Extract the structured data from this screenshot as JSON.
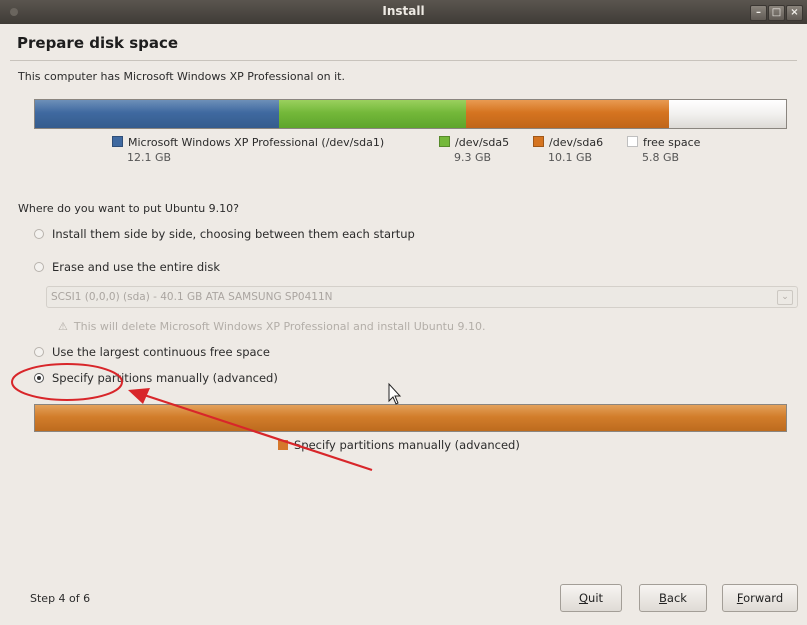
{
  "window": {
    "title": "Install",
    "controls": [
      "minimize",
      "maximize",
      "close"
    ]
  },
  "page": {
    "heading": "Prepare disk space",
    "intro": "This computer has Microsoft Windows XP Professional on it."
  },
  "disk_bar": {
    "segments": [
      {
        "label": "Microsoft Windows XP Professional (/dev/sda1)",
        "size": "12.1 GB",
        "gb": 12.1,
        "color": "#3f69a0"
      },
      {
        "label": "/dev/sda5",
        "size": "9.3 GB",
        "gb": 9.3,
        "color": "#74b83a"
      },
      {
        "label": "/dev/sda6",
        "size": "10.1 GB",
        "gb": 10.1,
        "color": "#d57420"
      },
      {
        "label": "free space",
        "size": "5.8 GB",
        "gb": 5.8,
        "color": "#ffffff"
      }
    ]
  },
  "question": "Where do you want to put Ubuntu 9.10?",
  "options": {
    "side_by_side": "Install them side by side, choosing between them each startup",
    "erase": "Erase and use the entire disk",
    "disk_select": "SCSI1 (0,0,0) (sda) - 40.1 GB ATA SAMSUNG SP0411N",
    "warning": "This will delete Microsoft Windows XP Professional and install Ubuntu 9.10.",
    "largest_free": "Use the largest continuous free space",
    "manual": "Specify partitions manually (advanced)",
    "selected": "manual"
  },
  "result_bar": {
    "label": "Specify partitions manually (advanced)",
    "color": "#d5782a"
  },
  "footer": {
    "step": "Step 4 of 6",
    "quit_letter": "Q",
    "quit_rest": "uit",
    "back_letter": "B",
    "back_rest": "ack",
    "forward_letter": "F",
    "forward_rest": "orward"
  },
  "icons": [
    "warning-icon",
    "mouse-pointer-icon",
    "annotation-circle",
    "annotation-arrow"
  ]
}
